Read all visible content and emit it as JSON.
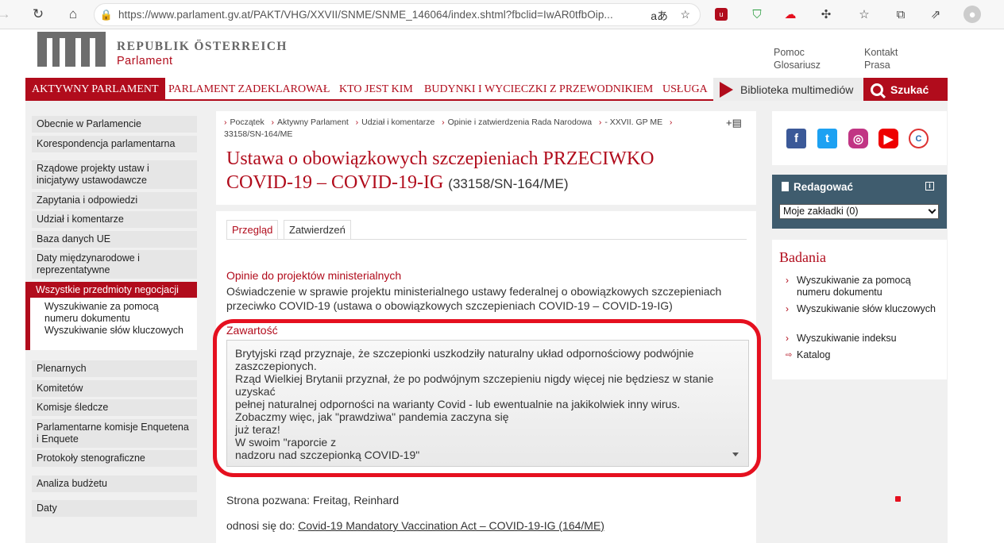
{
  "browser": {
    "url": "https://www.parlament.gv.at/PAKT/VHG/XXVII/SNME/SNME_146064/index.shtml?fbclid=IwAR0tfbOip...",
    "read_aloud_glyph": "aあ"
  },
  "header": {
    "logo_title": "REPUBLIK ÖSTERREICH",
    "logo_sub": "Parlament",
    "links_col1": [
      "Pomoc",
      "Glosariusz"
    ],
    "links_col2": [
      "Kontakt",
      "Prasa"
    ]
  },
  "mainnav": {
    "items": [
      "AKTYWNY PARLAMENT",
      "PARLAMENT ZADEKLAROWAŁ",
      "KTO JEST KIM",
      "BUDYNKI I WYCIECZKI Z PRZEWODNIKIEM",
      "USŁUGA"
    ],
    "media": "Biblioteka multimediów",
    "search": "Szukać"
  },
  "sidebar": {
    "items": [
      "Obecnie w Parlamencie",
      "Korespondencja parlamentarna",
      "Rządowe projekty ustaw i inicjatywy ustawodawcze",
      "Zapytania i odpowiedzi",
      "Udział i komentarze",
      "Baza danych UE",
      "Daty międzynarodowe i reprezentatywne",
      "Wszystkie przedmioty negocjacji",
      "Plenarnych",
      "Komitetów",
      "Komisje śledcze",
      "Parlamentarne komisje Enquetena i Enquete",
      "Protokoły stenograficzne",
      "Analiza budżetu",
      "Daty"
    ],
    "subitems": [
      "Wyszukiwanie za pomocą numeru dokumentu",
      "Wyszukiwanie słów kluczowych"
    ]
  },
  "breadcrumb": {
    "items": [
      "Początek",
      "Aktywny Parlament",
      "Udział i komentarze",
      "Opinie i zatwierdzenia Rada Narodowa",
      "- XXVII. GP ME",
      ""
    ],
    "last": "33158/SN-164/ME"
  },
  "page": {
    "title": "Ustawa o obowiązkowych szczepieniach PRZECIWKO COVID-19 – COVID-19-IG",
    "doc_number": "(33158/SN-164/ME)",
    "tabs": [
      "Przegląd",
      "Zatwierdzeń"
    ],
    "section_heading": "Opinie do projektów ministerialnych",
    "section_text": "Oświadczenie w sprawie projektu ministerialnego ustawy federalnej o obowiązkowych szczepieniach przeciwko COVID-19 (ustawa o obowiązkowych szczepieniach COVID-19 – COVID-19-IG)",
    "content_label": "Zawartość",
    "content_lines": [
      "Brytyjski rząd przyznaje, że szczepionki uszkodziły naturalny układ odpornościowy podwójnie",
      "zaszczepionych.",
      "Rząd Wielkiej Brytanii przyznał, że po podwójnym szczepieniu nigdy więcej nie będziesz w stanie",
      "uzyskać",
      "pełnej naturalnej odporności na warianty Covid - lub ewentualnie na jakikolwiek inny wirus.",
      "Zobaczmy więc, jak \"prawdziwa\" pandemia zaczyna się",
      "już teraz!",
      "W swoim \"raporcie z",
      "nadzoru nad szczepionką COVID-19\""
    ],
    "party_label": "Strona pozwana:",
    "party_value": "Freitag, Reinhard",
    "refers_label": "odnosi się do:",
    "refers_link": "Covid-19 Mandatory Vaccination Act – COVID-19-IG (164/ME)"
  },
  "right": {
    "edit_title": "Redagować",
    "bookmarks_select": "Moje zakładki (0)",
    "research_title": "Badania",
    "research_links": [
      "Wyszukiwanie za pomocą numeru dokumentu",
      "Wyszukiwanie słów kluczowych",
      "Wyszukiwanie indeksu",
      "Katalog"
    ]
  },
  "colors": {
    "accent": "#b10c1c",
    "highlight": "#e5101f",
    "panel": "#3f5c6e"
  }
}
